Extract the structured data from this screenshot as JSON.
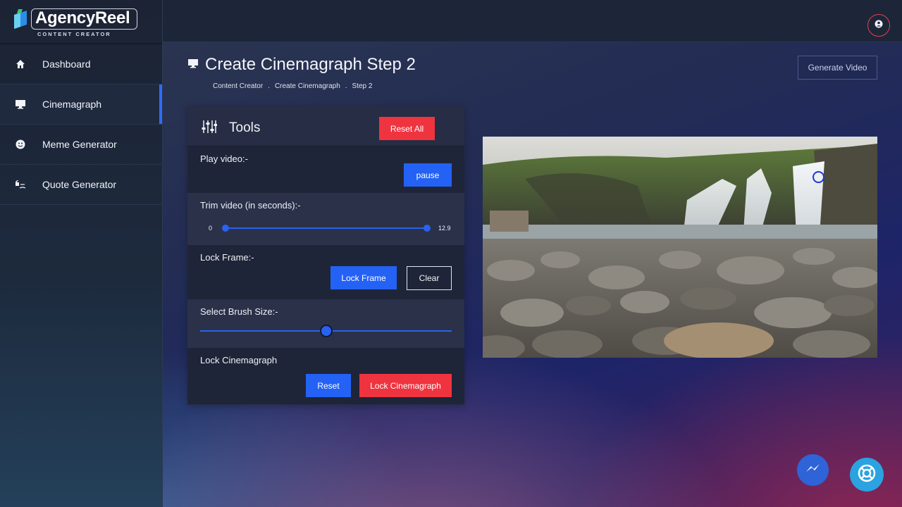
{
  "brand": {
    "name": "AgencyReel",
    "tagline": "CONTENT CREATOR"
  },
  "sidebar": {
    "items": [
      {
        "label": "Dashboard",
        "icon": "home-icon",
        "active": false
      },
      {
        "label": "Cinemagraph",
        "icon": "monitor-icon",
        "active": true
      },
      {
        "label": "Meme Generator",
        "icon": "smiley-icon",
        "active": false
      },
      {
        "label": "Quote Generator",
        "icon": "quote-icon",
        "active": false
      }
    ]
  },
  "topbar": {
    "user_icon": "user-icon"
  },
  "page": {
    "title": "Create Cinemagraph Step 2",
    "breadcrumb": [
      "Content Creator",
      "Create Cinemagraph",
      "Step 2"
    ],
    "breadcrumb_separator": ".",
    "generate_label": "Generate Video"
  },
  "tools": {
    "title": "Tools",
    "reset_all_label": "Reset All",
    "play": {
      "label": "Play video:-",
      "button": "pause"
    },
    "trim": {
      "label": "Trim video (in seconds):-",
      "min_label": "0",
      "max_label": "12.9",
      "start": 0,
      "end": 12.9
    },
    "lock_frame": {
      "label": "Lock Frame:-",
      "lock_button": "Lock Frame",
      "clear_button": "Clear"
    },
    "brush": {
      "label": "Select Brush Size:-",
      "level": 0.5
    },
    "lock_cinemagraph": {
      "label": "Lock Cinemagraph",
      "reset_button": "Reset",
      "lock_button": "Lock Cinemagraph"
    }
  },
  "preview": {
    "subject": "waterfall over rocky riverbed",
    "brush_marker": "brush-cursor-icon"
  },
  "floating": {
    "messenger_icon": "messenger-icon",
    "help_icon": "lifebuoy-icon"
  },
  "colors": {
    "accent_blue": "#2462f5",
    "accent_red": "#ef3440",
    "active_bar": "#2f6bff"
  }
}
